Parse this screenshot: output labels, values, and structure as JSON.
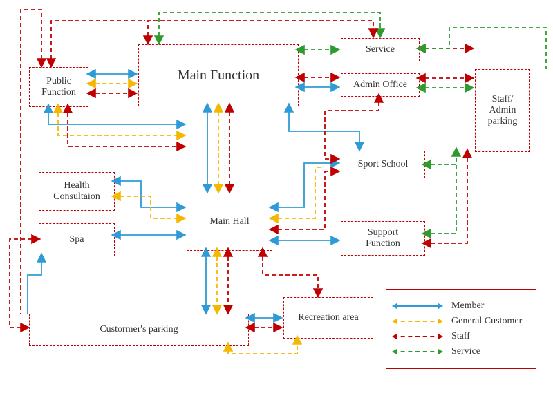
{
  "boxes": {
    "main_function": "Main Function",
    "public_function": "Public\nFunction",
    "service": "Service",
    "admin_office": "Admin Office",
    "staff_admin_parking": "Staff/\nAdmin\nparking",
    "sport_school": "Sport School",
    "health_consultation": "Health\nConsultaion",
    "main_hall": "Main Hall",
    "spa": "Spa",
    "support_function": "Support\nFunction",
    "customers_parking": "Custormer's parking",
    "recreation_area": "Recreation area"
  },
  "legend": {
    "member": "Member",
    "general_customer": "General Customer",
    "staff": "Staff",
    "service": "Service"
  },
  "colors": {
    "member": "#2F9BD6",
    "general_customer": "#F5B800",
    "staff": "#C00000",
    "service": "#2E9B2E"
  }
}
